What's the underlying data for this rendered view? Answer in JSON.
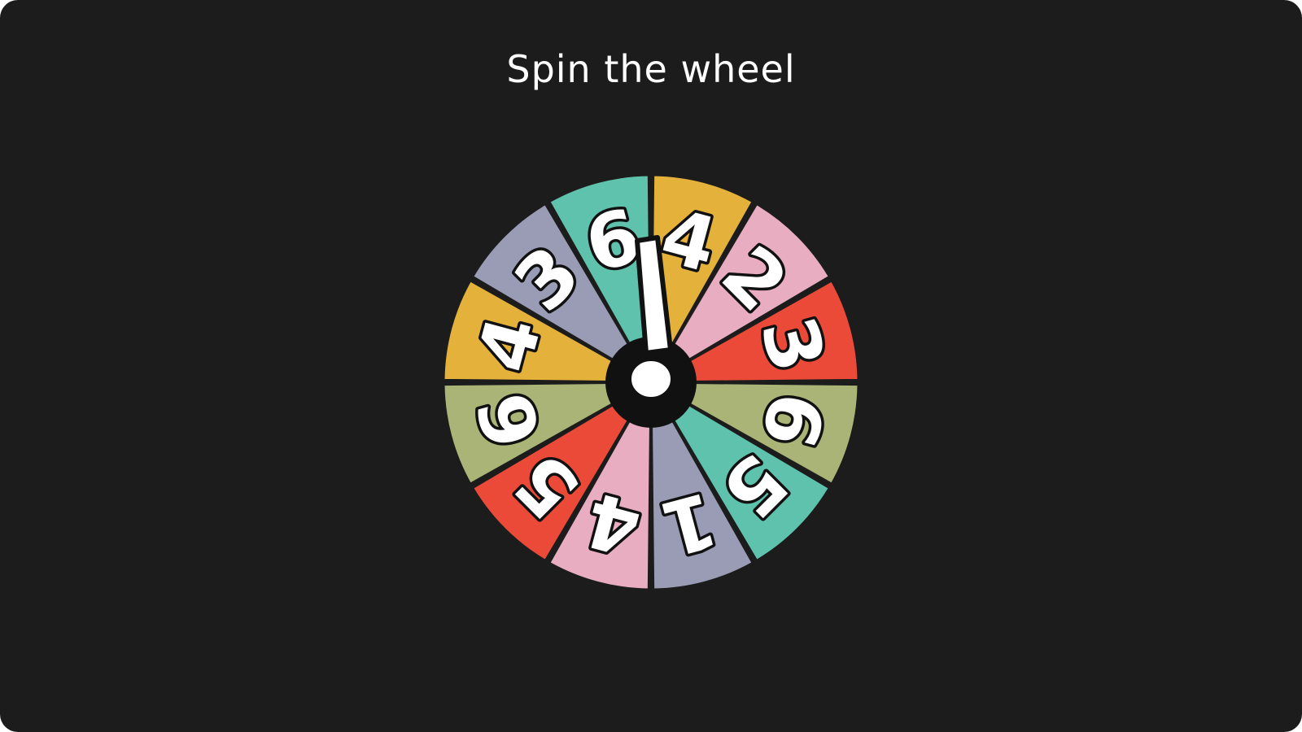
{
  "title": "Spin the wheel",
  "wheel": {
    "segments": [
      {
        "label": "4",
        "color": "#e4b23a"
      },
      {
        "label": "2",
        "color": "#e8adc0"
      },
      {
        "label": "3",
        "color": "#ec4a38"
      },
      {
        "label": "6",
        "color": "#aab476"
      },
      {
        "label": "5",
        "color": "#5ec2ad"
      },
      {
        "label": "1",
        "color": "#9a9cb5"
      },
      {
        "label": "4",
        "color": "#e8adc0"
      },
      {
        "label": "5",
        "color": "#ec4a38"
      },
      {
        "label": "6",
        "color": "#aab476"
      },
      {
        "label": "4",
        "color": "#e4b23a"
      },
      {
        "label": "3",
        "color": "#9a9cb5"
      },
      {
        "label": "6",
        "color": "#5ec2ad"
      }
    ],
    "hub_color": "#111111",
    "pointer_color": "#ffffff",
    "pointer_icon": "exclamation-pointer-icon"
  }
}
